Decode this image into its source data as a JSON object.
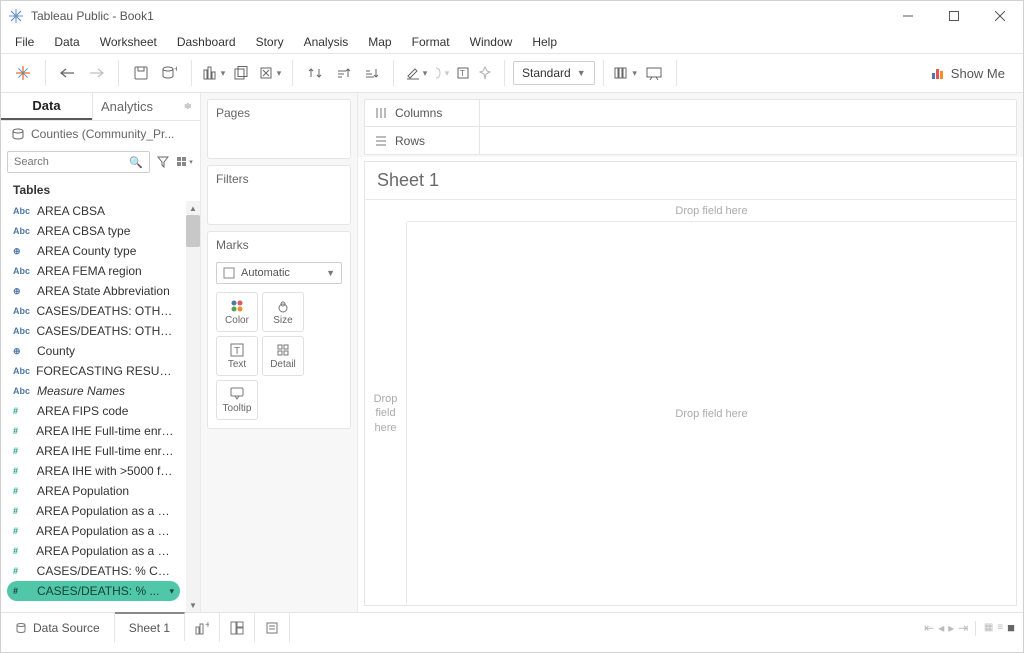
{
  "window": {
    "title": "Tableau Public - Book1"
  },
  "menu": [
    "File",
    "Data",
    "Worksheet",
    "Dashboard",
    "Story",
    "Analysis",
    "Map",
    "Format",
    "Window",
    "Help"
  ],
  "toolbar": {
    "sizing_mode": "Standard",
    "show_me": "Show Me"
  },
  "left_panel": {
    "tabs": {
      "data": "Data",
      "analytics": "Analytics"
    },
    "datasource": "Counties (Community_Pr...",
    "search_placeholder": "Search",
    "tables_header": "Tables",
    "fields": [
      {
        "icon": "abc",
        "label": "AREA CBSA"
      },
      {
        "icon": "abc",
        "label": "AREA CBSA type"
      },
      {
        "icon": "globe",
        "label": "AREA County type"
      },
      {
        "icon": "abc",
        "label": "AREA FEMA region"
      },
      {
        "icon": "globe",
        "label": "AREA State Abbreviation"
      },
      {
        "icon": "abc",
        "label": "CASES/DEATHS: OTHE..."
      },
      {
        "icon": "abc",
        "label": "CASES/DEATHS: OTHE..."
      },
      {
        "icon": "globe",
        "label": "County"
      },
      {
        "icon": "abc",
        "label": "FORECASTING RESULT..."
      },
      {
        "icon": "abc",
        "label": "Measure Names",
        "italic": true
      },
      {
        "icon": "hash",
        "label": "AREA FIPS code"
      },
      {
        "icon": "hash",
        "label": "AREA IHE Full-time enrol..."
      },
      {
        "icon": "hash",
        "label": "AREA IHE Full-time enrol..."
      },
      {
        "icon": "hash",
        "label": "AREA IHE with >5000 fu..."
      },
      {
        "icon": "hash",
        "label": "AREA Population"
      },
      {
        "icon": "hash",
        "label": "AREA Population as a pe..."
      },
      {
        "icon": "hash",
        "label": "AREA Population as a pe..."
      },
      {
        "icon": "hash",
        "label": "AREA Population as a pe..."
      },
      {
        "icon": "hash",
        "label": "CASES/DEATHS: % CH..."
      },
      {
        "icon": "hash",
        "label": "CASES/DEATHS: % ...",
        "highlighted": true
      }
    ]
  },
  "shelves": {
    "pages": "Pages",
    "filters": "Filters",
    "marks": "Marks",
    "mark_type": "Automatic",
    "mark_cells": [
      "Color",
      "Size",
      "Text",
      "Detail",
      "Tooltip"
    ]
  },
  "worksheet": {
    "columns_label": "Columns",
    "rows_label": "Rows",
    "sheet_title": "Sheet 1",
    "drop_col": "Drop field here",
    "drop_row": "Drop\nfield\nhere",
    "drop_cell": "Drop field here"
  },
  "bottom": {
    "data_source": "Data Source",
    "sheet_tab": "Sheet 1"
  }
}
